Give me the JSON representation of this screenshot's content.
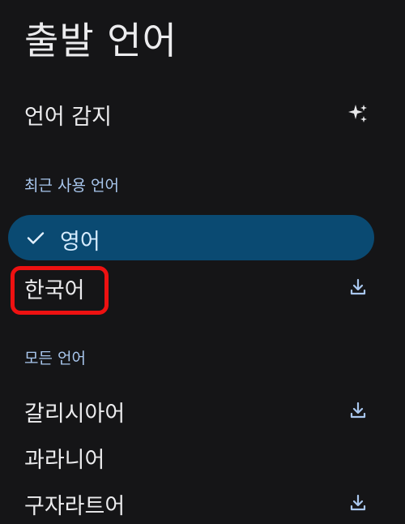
{
  "header": {
    "title": "출발 언어"
  },
  "detect": {
    "label": "언어 감지",
    "icon": "sparkle-icon"
  },
  "recent": {
    "header": "최근 사용 언어",
    "selected": {
      "label": "영어",
      "icon": "check-icon"
    },
    "items": [
      {
        "label": "한국어",
        "icon": "download-icon"
      }
    ]
  },
  "all": {
    "header": "모든 언어",
    "items": [
      {
        "label": "갈리시아어",
        "icon": "download-icon"
      },
      {
        "label": "과라니어",
        "icon": ""
      },
      {
        "label": "구자라트어",
        "icon": "download-icon"
      }
    ]
  },
  "colors": {
    "background": "#151517",
    "selected_pill": "#0a4a72",
    "section_header": "#a9c7ee",
    "highlight": "#ee1111"
  }
}
